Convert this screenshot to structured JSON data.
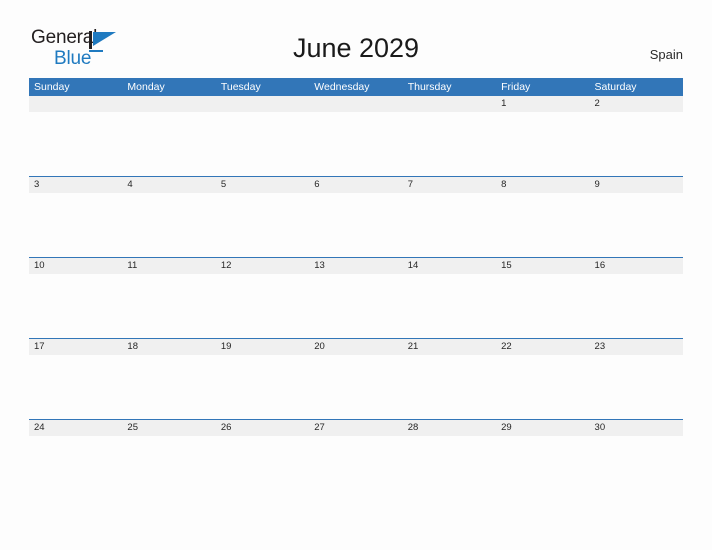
{
  "brand": {
    "name_part1": "General",
    "name_part2": "Blue",
    "mark": "triangle-flag-icon"
  },
  "header": {
    "title": "June 2029",
    "country": "Spain"
  },
  "colors": {
    "header_blue": "#3276b8",
    "brand_blue": "#1f7ac0",
    "date_band": "#f0f0f0",
    "page_background": "#fdfdfd",
    "text_dark": "#231f20"
  },
  "calendar": {
    "month": "June",
    "year": "2029",
    "weekday_headers": [
      "Sunday",
      "Monday",
      "Tuesday",
      "Wednesday",
      "Thursday",
      "Friday",
      "Saturday"
    ],
    "weeks": [
      {
        "days": [
          "",
          "",
          "",
          "",
          "",
          "1",
          "2"
        ]
      },
      {
        "days": [
          "3",
          "4",
          "5",
          "6",
          "7",
          "8",
          "9"
        ]
      },
      {
        "days": [
          "10",
          "11",
          "12",
          "13",
          "14",
          "15",
          "16"
        ]
      },
      {
        "days": [
          "17",
          "18",
          "19",
          "20",
          "21",
          "22",
          "23"
        ]
      },
      {
        "days": [
          "24",
          "25",
          "26",
          "27",
          "28",
          "29",
          "30"
        ]
      }
    ]
  }
}
